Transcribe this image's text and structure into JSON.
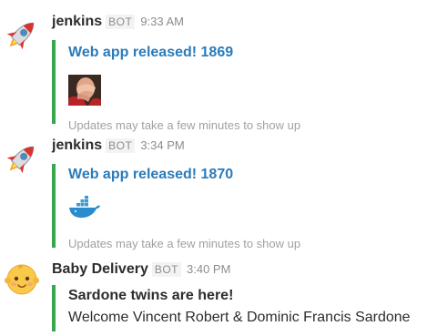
{
  "messages": [
    {
      "sender": "jenkins",
      "badge": "BOT",
      "time": "9:33 AM",
      "avatar_icon": "rocket-icon",
      "attachment": {
        "title": "Web app released! 1869",
        "thumb_icon": "facepalm-icon",
        "footer": "Updates may take a few minutes to show up",
        "accent": "#36a64f"
      }
    },
    {
      "sender": "jenkins",
      "badge": "BOT",
      "time": "3:34 PM",
      "avatar_icon": "rocket-icon",
      "attachment": {
        "title": "Web app released! 1870",
        "thumb_icon": "docker-whale-icon",
        "footer": "Updates may take a few minutes to show up",
        "accent": "#36a64f"
      }
    },
    {
      "sender": "Baby Delivery",
      "badge": "BOT",
      "time": "3:40 PM",
      "avatar_icon": "baby-face-icon",
      "attachment": {
        "title": "Sardone twins are here!",
        "text": "Welcome Vincent Robert & Dominic Francis Sardone",
        "accent": "#36a64f"
      }
    }
  ]
}
